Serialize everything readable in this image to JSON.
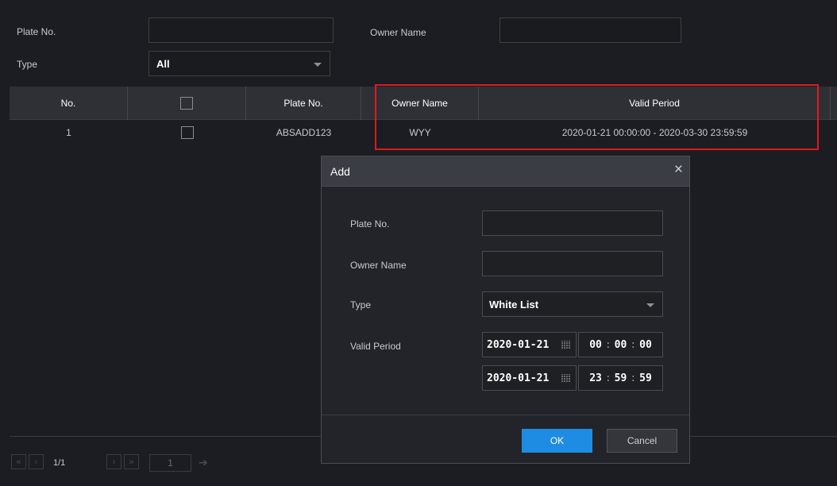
{
  "filter": {
    "plate_label": "Plate No.",
    "owner_label": "Owner Name",
    "type_label": "Type",
    "type_value": "All"
  },
  "table": {
    "headers": [
      "No.",
      "",
      "Plate No.",
      "Owner Name",
      "Valid Period"
    ],
    "rows": [
      {
        "no": "1",
        "plate": "ABSADD123",
        "owner": "WYY",
        "period": "2020-01-21 00:00:00 - 2020-03-30 23:59:59"
      }
    ]
  },
  "pager": {
    "page_info": "1/1",
    "page_input": "1"
  },
  "dialog": {
    "title": "Add",
    "close_glyph": "×",
    "plate_label": "Plate No.",
    "owner_label": "Owner Name",
    "type_label": "Type",
    "type_value": "White List",
    "period_label": "Valid Period",
    "start_date": "2020-01-21",
    "start_hh": "00",
    "start_mm": "00",
    "start_ss": "00",
    "end_date": "2020-01-21",
    "end_hh": "23",
    "end_mm": "59",
    "end_ss": "59",
    "ok_label": "OK",
    "cancel_label": "Cancel"
  },
  "colors": {
    "accent": "#1e8ce3",
    "highlight": "#e1171e"
  }
}
